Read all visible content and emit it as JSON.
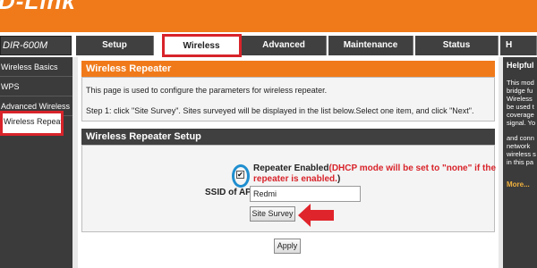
{
  "brand": {
    "logo": "D-Link"
  },
  "model": "DIR-600M",
  "tabs": [
    {
      "label": "Setup"
    },
    {
      "label": "Wireless"
    },
    {
      "label": "Advanced"
    },
    {
      "label": "Maintenance"
    },
    {
      "label": "Status"
    },
    {
      "label": "H"
    }
  ],
  "sidebar": {
    "items": [
      {
        "label": "Wireless Basics"
      },
      {
        "label": "WPS"
      },
      {
        "label": "Advanced Wireless"
      },
      {
        "label": "Wireless Repeater"
      }
    ]
  },
  "repeater": {
    "title": "Wireless Repeater",
    "description": "This page is used to configure the parameters for wireless repeater.",
    "step1": "Step 1: click \"Site Survey\". Sites surveyed will be displayed in the list below.Select one item, and click \"Next\"."
  },
  "setup": {
    "title": "Wireless Repeater Setup",
    "checkbox_mark": "✔",
    "repeater_enabled_label": "Repeater Enabled",
    "dhcp_warning_1": "(DHCP mode will be set to \"none\" if the",
    "dhcp_warning_2": "repeater is enabled.",
    "dhcp_warning_end": ")",
    "ssid_label": "SSID of AP",
    "ssid_value": "Redmi",
    "site_survey_label": "Site Survey",
    "apply_label": "Apply"
  },
  "help": {
    "title": "Helpful",
    "lines": [
      "This mod",
      "bridge fu",
      "Wireless",
      "be used t",
      "coverage",
      "signal. Yo",
      "and conn",
      "network",
      "wireless s",
      "in this pa"
    ],
    "more": "More..."
  },
  "colors": {
    "brand_orange": "#f07a1a",
    "nav_dark": "#404040",
    "highlight_red": "#d8232a",
    "circle_blue": "#1f8ecf"
  }
}
